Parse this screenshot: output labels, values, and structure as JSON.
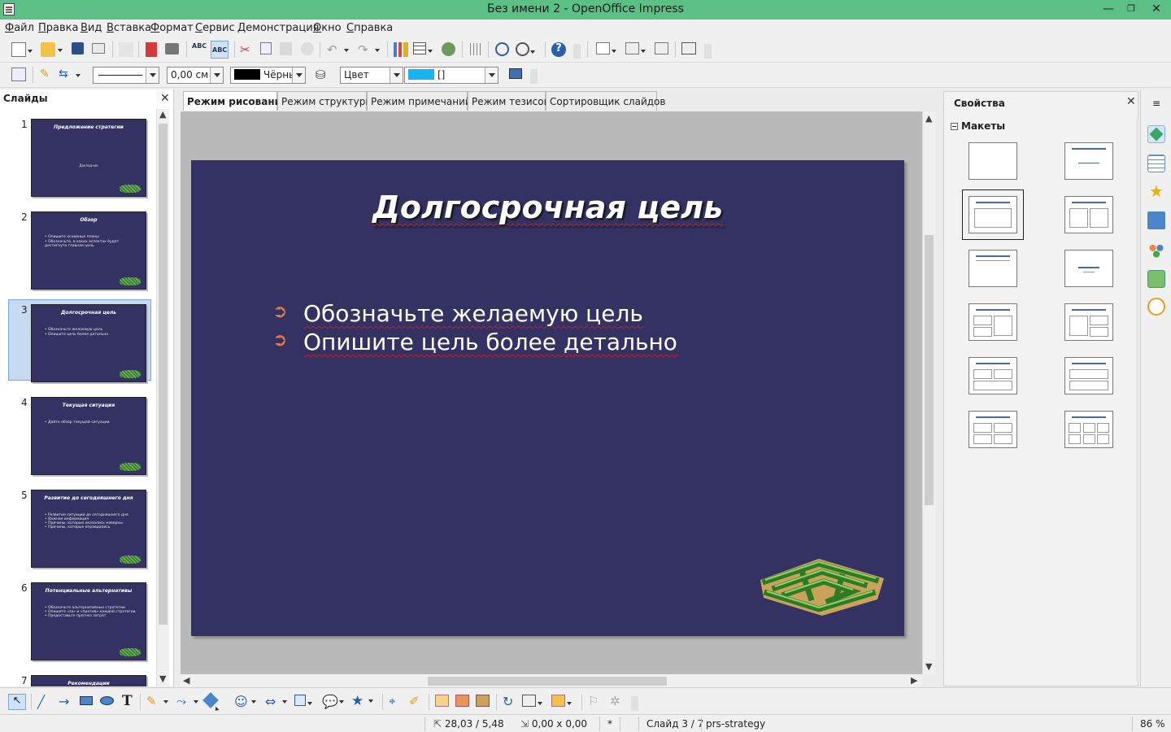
{
  "window": {
    "title": "Без имени 2 - OpenOffice Impress",
    "minimize": "—",
    "maximize": "❐",
    "close": "✕"
  },
  "menu": [
    "Файл",
    "Правка",
    "Вид",
    "Вставка",
    "Формат",
    "Сервис",
    "Демонстрация",
    "Окно",
    "Справка"
  ],
  "format_toolbar": {
    "line_width": "0,00 см",
    "line_color": "Чёрнь",
    "area_style": "Цвет",
    "area_color": "[]"
  },
  "slides_pane": {
    "title": "Слайды",
    "close": "✕",
    "slides": [
      {
        "num": "1",
        "title": "Предложение стратегии",
        "subtitle": "Докладчик",
        "bullets": []
      },
      {
        "num": "2",
        "title": "Обзор",
        "bullets": [
          "Опишите основные планы",
          "Обозначьте, в каких аспектах будет достигнута главная цель"
        ]
      },
      {
        "num": "3",
        "title": "Долгосрочная цель",
        "bullets": [
          "Обозначьте желаемую цель",
          "Опишите цель более детально"
        ]
      },
      {
        "num": "4",
        "title": "Текущая ситуация",
        "bullets": [
          "Дайте обзор текущей ситуации"
        ]
      },
      {
        "num": "5",
        "title": "Развитие до сегодняшнего дня",
        "bullets": [
          "Развитие ситуации до сегодняшнего дня",
          "Важная информация",
          "Причины, которые оказались неверны",
          "Причины, которые оправдались"
        ]
      },
      {
        "num": "6",
        "title": "Потенциальные альтернативы",
        "bullets": [
          "Обозначьте альтернативные стратегии",
          "Опишите «за» и «против» каждой стратегии",
          "Предоставьте прогноз затрат"
        ]
      },
      {
        "num": "7",
        "title": "Рекомендации",
        "bullets": []
      }
    ]
  },
  "tabs": [
    "Режим рисования",
    "Режим структуры",
    "Режим примечаний",
    "Режим тезисов",
    "Сортировщик слайдов"
  ],
  "current_slide": {
    "title": "Долгосрочная цель",
    "bullet_glyph": "➲",
    "bullets": [
      "Обозначьте желаемую цель",
      "Опишите цель более детально"
    ]
  },
  "properties": {
    "title": "Свойства",
    "close": "✕",
    "section": "Макеты"
  },
  "status": {
    "position": "28,03 / 5,48",
    "size": "0,00 x 0,00",
    "modified": "*",
    "slide": "Слайд 3 / 7",
    "master": "prs-strategy",
    "zoom": "86 %"
  },
  "colors": {
    "slide_bg": "#343262",
    "titlebar": "#5bbf86",
    "bullet": "#e27b4a",
    "area_color": "#18b4f0"
  }
}
